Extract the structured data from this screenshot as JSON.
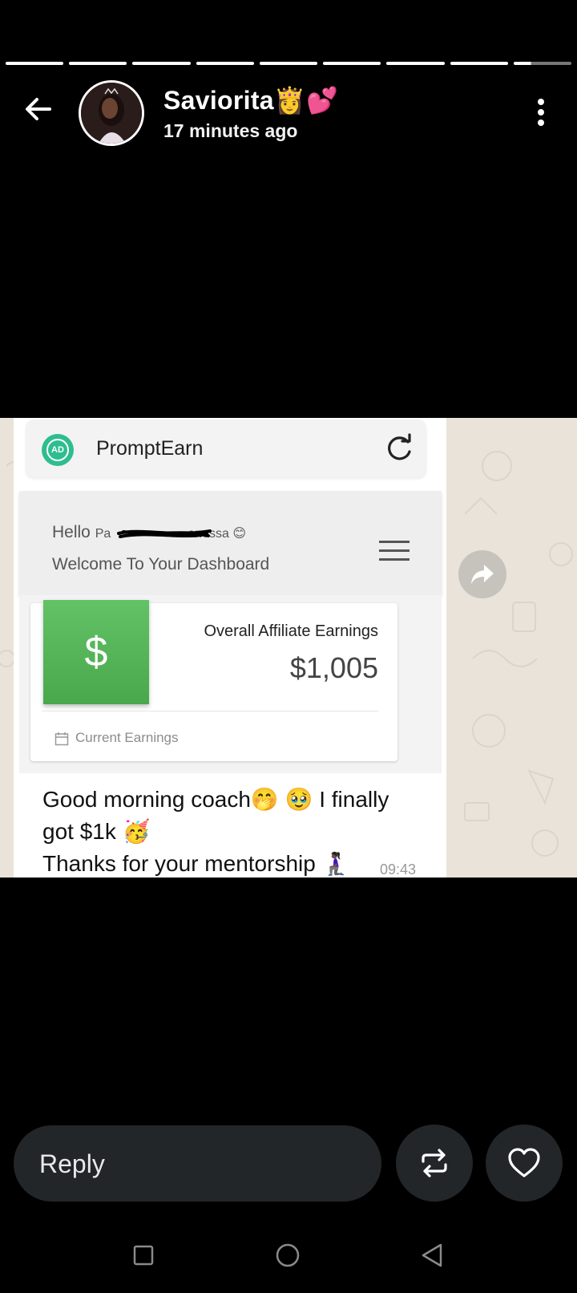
{
  "story_progress": {
    "segments": 9,
    "current": 9,
    "current_fraction": 0.3
  },
  "header": {
    "user_name": "Saviorita👸💕",
    "time_ago": "17 minutes ago"
  },
  "story_content": {
    "app": {
      "logo_text": "AD",
      "title": "PromptEarn"
    },
    "dashboard": {
      "hello_prefix": "Hello",
      "hello_name_visible_start": "Pa",
      "hello_name_visible_end": "anessa 😊",
      "welcome": "Welcome To Your Dashboard"
    },
    "earnings": {
      "currency_symbol": "$",
      "label": "Overall Affiliate Earnings",
      "value": "$1,005",
      "footer": "Current Earnings"
    },
    "message": {
      "line1": "Good morning coach🤭 🥹  I finally",
      "line2": "got $1k 🥳",
      "line3": "Thanks for your mentorship 🧎🏿‍♀️",
      "time": "09:43"
    }
  },
  "reply_bar": {
    "placeholder": "Reply"
  },
  "icons": {
    "back": "arrow-left-icon",
    "menu": "more-vertical-icon",
    "refresh": "refresh-icon",
    "forward": "forward-icon",
    "repost": "repost-icon",
    "like": "heart-icon",
    "nav_recents": "square-icon",
    "nav_home": "circle-icon",
    "nav_back": "triangle-back-icon"
  },
  "colors": {
    "background": "#000000",
    "brand_green": "#2ebd8f",
    "earnings_green": "#4caf50",
    "control_bg": "#222629"
  }
}
